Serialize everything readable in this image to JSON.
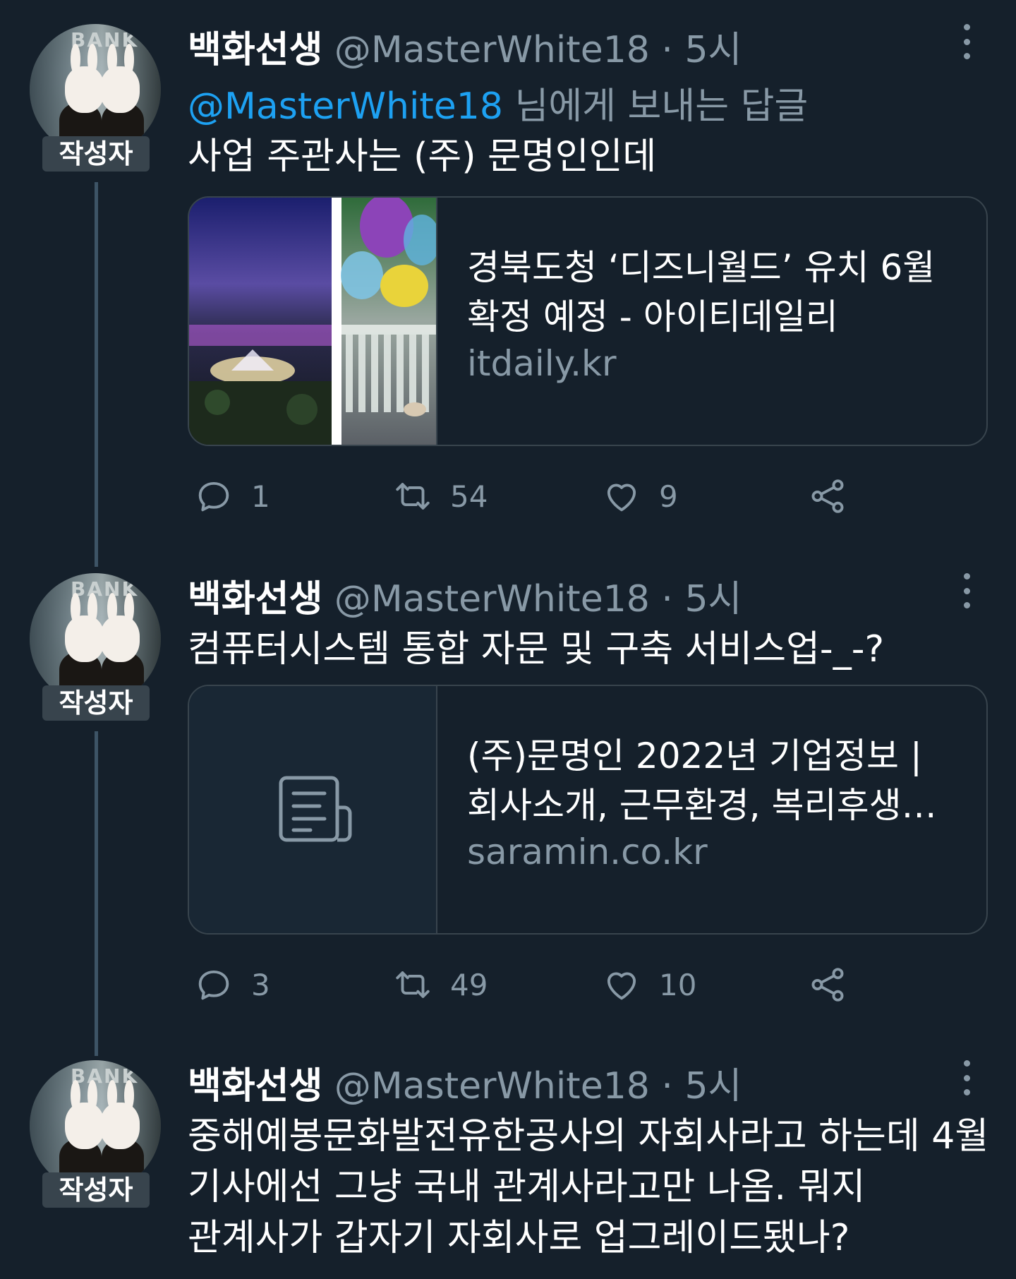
{
  "tweets": [
    {
      "author_name": "백화선생",
      "handle": "@MasterWhite18",
      "separator": "·",
      "time": "5시",
      "author_badge": "작성자",
      "reply_prefix": "@MasterWhite18",
      "reply_suffix": " 님에게 보내는 답글",
      "text": "사업 주관사는 (주) 문명인인데",
      "card": {
        "title": "경북도청 ‘디즈니월드’ 유치 6월 확정 예정 - 아이티데일리",
        "domain": "itdaily.kr",
        "media": "resort-night-and-balloons-photo"
      },
      "replies": "1",
      "retweets": "54",
      "likes": "9"
    },
    {
      "author_name": "백화선생",
      "handle": "@MasterWhite18",
      "separator": "·",
      "time": "5시",
      "author_badge": "작성자",
      "text": "컴퓨터시스템 통합 자문 및 구축 서비스업-_-?",
      "card": {
        "title": "(주)문명인 2022년 기업정보 | 회사소개, 근무환경, 복리후생…",
        "domain": "saramin.co.kr",
        "media": "document-icon"
      },
      "replies": "3",
      "retweets": "49",
      "likes": "10"
    },
    {
      "author_name": "백화선생",
      "handle": "@MasterWhite18",
      "separator": "·",
      "time": "5시",
      "author_badge": "작성자",
      "text_lines": [
        "중해예봉문화발전유한공사의 자회사라고 하는데 4월",
        "기사에선 그냥 국내 관계사라고만 나옴. 뭐지",
        "관계사가 갑자기 자회사로 업그레이드됐나?"
      ]
    }
  ],
  "avatar_sign": "BANK",
  "colors": {
    "background": "#15202b",
    "secondary_text": "#8899a6",
    "link": "#1da1f2",
    "border": "#38444d"
  }
}
